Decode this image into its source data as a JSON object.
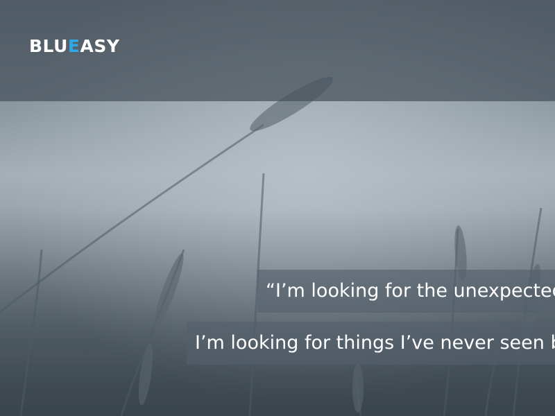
{
  "header": {
    "logo": {
      "part1": "BLU",
      "part2": "E",
      "part3": "ASY"
    }
  },
  "hero": {
    "quote_line_1": "“I’m looking for the unexpected.",
    "quote_line_2": "I’m looking for things I’ve never seen before.”"
  },
  "colors": {
    "accent": "#2fa8ea",
    "header_bg": "#46525c",
    "text": "#ffffff"
  }
}
